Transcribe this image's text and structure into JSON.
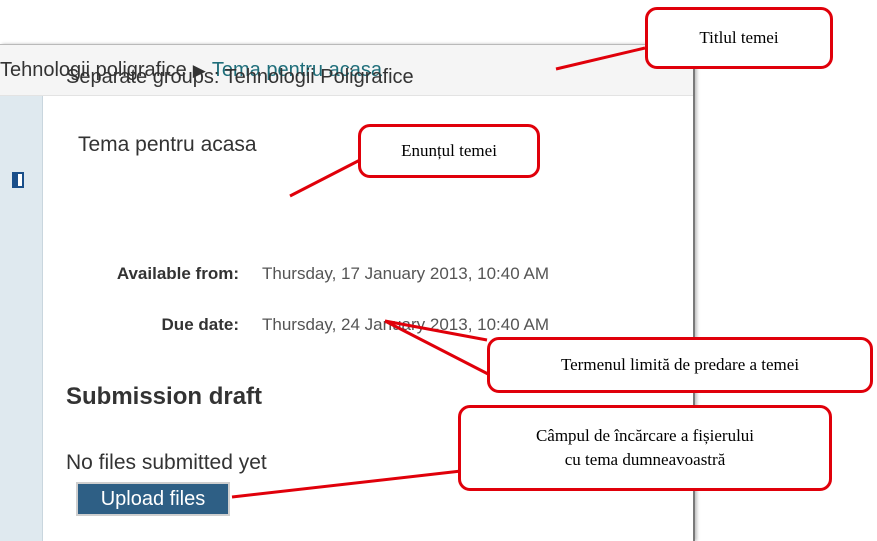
{
  "breadcrumb": {
    "root": "Tehnologii poligrafice",
    "separator": "▶",
    "current": "Tema pentru acasa"
  },
  "groups_label": "Separate groups: Tehnologii Poligrafice",
  "task_title": "Tema pentru acasa",
  "dates": {
    "available_label": "Available from:",
    "available_value": "Thursday, 17 January 2013, 10:40 AM",
    "due_label": "Due date:",
    "due_value": "Thursday, 24 January 2013, 10:40 AM"
  },
  "submission": {
    "heading": "Submission draft",
    "status": "No files submitted yet",
    "upload_button": "Upload files"
  },
  "callouts": {
    "title": "Titlul temei",
    "statement": "Enunțul temei",
    "deadline": "Termenul limită de predare a temei",
    "upload_line1": "Câmpul de încărcare a fișierului",
    "upload_line2": "cu tema dumneavoastră"
  },
  "colors": {
    "callout_border": "#e0000a",
    "link": "#1f6e7a",
    "button": "#2e5f85"
  }
}
